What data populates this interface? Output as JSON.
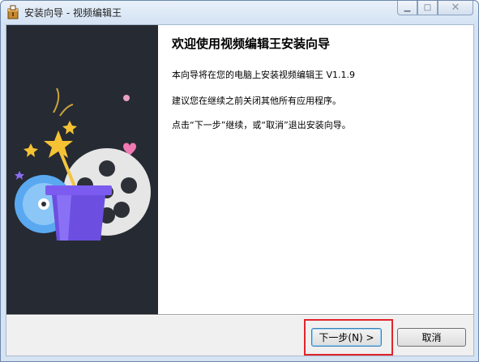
{
  "window": {
    "title": "安装向导 - 视频编辑王",
    "app_icon": "installer-box-icon",
    "controls": {
      "minimize": "minimize-icon",
      "maximize": "maximize-icon",
      "close": "close-icon"
    }
  },
  "wizard": {
    "heading": "欢迎使用视频编辑王安装向导",
    "line1": "本向导将在您的电脑上安装视频编辑王 V1.1.9",
    "line2": "建议您在继续之前关闭其他所有应用程序。",
    "line3": "点击“下一步”继续，或“取消”退出安装向导。"
  },
  "buttons": {
    "next": "下一步(N) >",
    "cancel": "取消"
  },
  "colors": {
    "side_panel": "#262a33",
    "highlight_box": "#e0242c",
    "accent_purple": "#7c5cf0",
    "accent_blue": "#5aa9f0",
    "star": "#f5c233"
  }
}
